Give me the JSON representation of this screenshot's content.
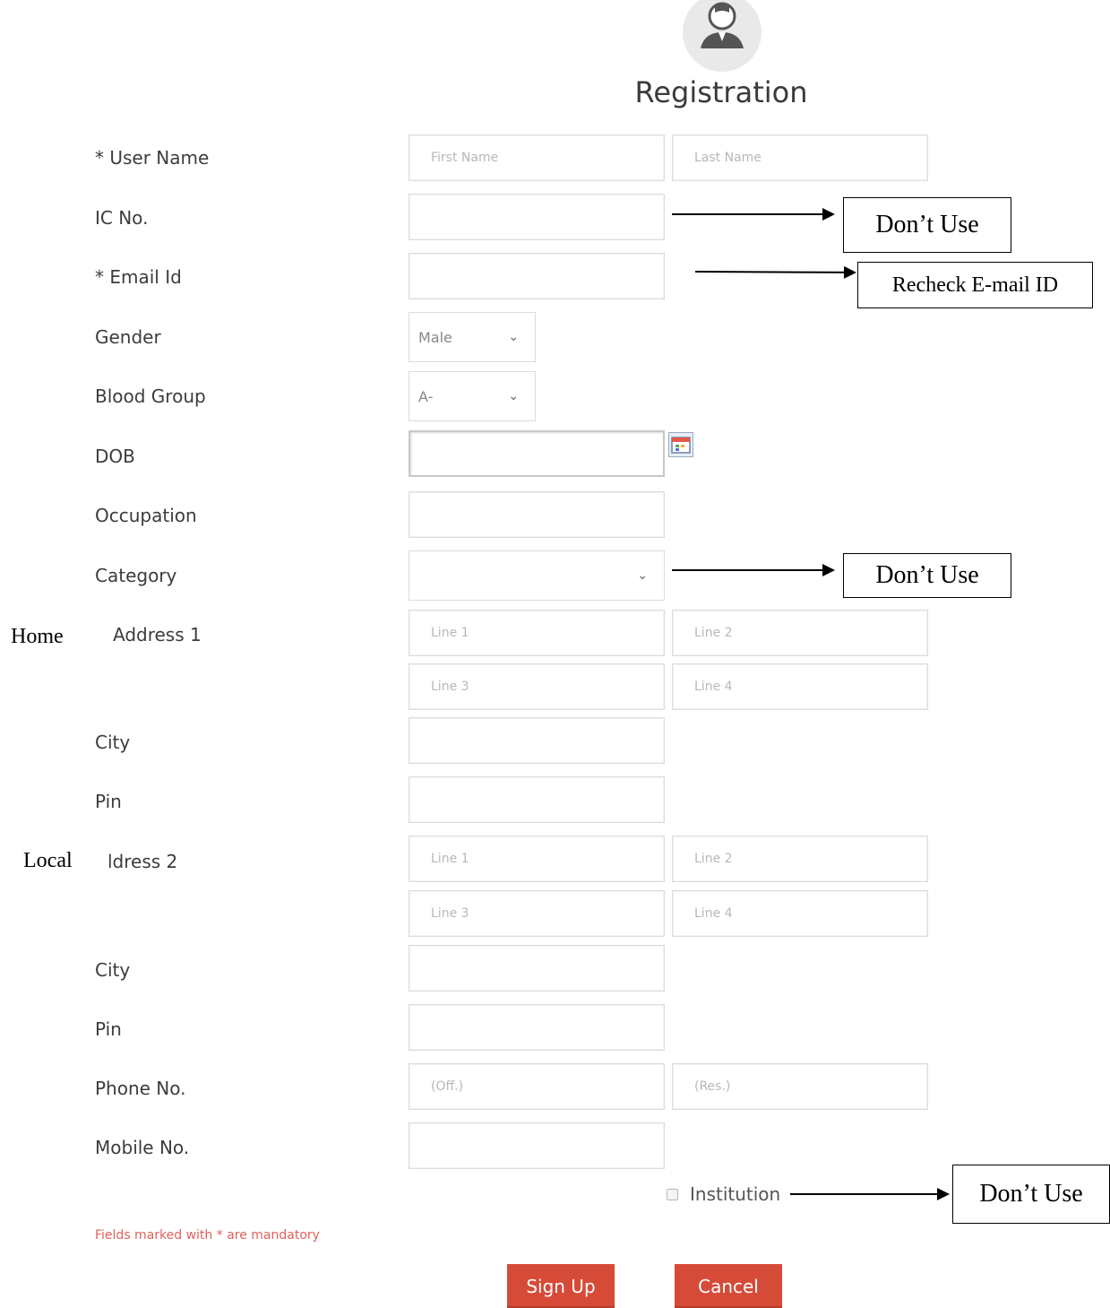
{
  "header": {
    "title": "Registration"
  },
  "side_labels": {
    "home": "Home",
    "local": "Local"
  },
  "fields": {
    "user_name": {
      "label": "* User Name",
      "first_placeholder": "First Name",
      "last_placeholder": "Last Name"
    },
    "ic_no": {
      "label": "IC No."
    },
    "email": {
      "label": "* Email Id"
    },
    "gender": {
      "label": "Gender",
      "value": "Male"
    },
    "blood_group": {
      "label": "Blood Group",
      "value": "A-"
    },
    "dob": {
      "label": "DOB"
    },
    "occupation": {
      "label": "Occupation"
    },
    "category": {
      "label": "Category",
      "value": ""
    },
    "address1": {
      "label": "Address 1",
      "line1": "Line 1",
      "line2": "Line 2",
      "line3": "Line 3",
      "line4": "Line 4"
    },
    "city1": {
      "label": "City"
    },
    "pin1": {
      "label": "Pin"
    },
    "address2": {
      "label": "ldress 2",
      "line1": "Line 1",
      "line2": "Line 2",
      "line3": "Line 3",
      "line4": "Line 4"
    },
    "city2": {
      "label": "City"
    },
    "pin2": {
      "label": "Pin"
    },
    "phone": {
      "label": "Phone No.",
      "off_placeholder": "(Off.)",
      "res_placeholder": "(Res.)"
    },
    "mobile": {
      "label": "Mobile No."
    }
  },
  "institution": {
    "label": "Institution",
    "checked": false
  },
  "mandatory_note": "Fields marked with * are mandatory",
  "annotations": {
    "ic_no": "Don’t Use",
    "email": "Recheck E-mail ID",
    "category": "Don’t Use",
    "institution": "Don’t Use"
  },
  "buttons": {
    "sign_up": "Sign Up",
    "cancel": "Cancel"
  },
  "colors": {
    "button": "#d64a38",
    "mandatory_text": "#e0605a"
  }
}
